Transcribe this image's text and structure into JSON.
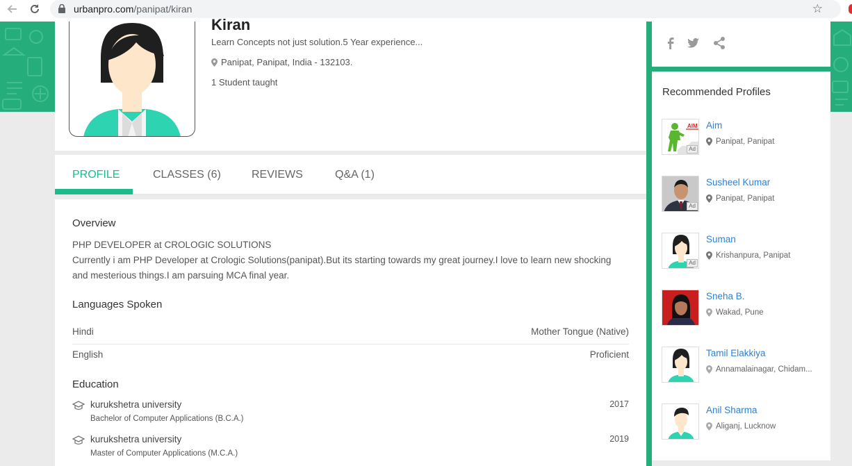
{
  "browser": {
    "url_host": "urbanpro.com",
    "url_path": "/panipat/kiran"
  },
  "profile": {
    "name": "Kiran",
    "tagline": "Learn Concepts not just solution.5 Year experience...",
    "location": "Panipat, Panipat, India - 132103.",
    "students": "1 Student taught"
  },
  "tabs": {
    "profile": "PROFILE",
    "classes": "CLASSES (6)",
    "reviews": "REVIEWS",
    "qa": "Q&A (1)"
  },
  "overview": {
    "title": "Overview",
    "line1": "PHP DEVELOPER at CROLOGIC SOLUTIONS",
    "line2": "Currently i am PHP Developer at Crologic Solutions(panipat).But its starting towards my great journey.I love to learn new shocking and mesterious things.I am parsuing MCA final year."
  },
  "languages": {
    "title": "Languages Spoken",
    "items": [
      {
        "name": "Hindi",
        "level": "Mother Tongue (Native)"
      },
      {
        "name": "English",
        "level": "Proficient"
      }
    ]
  },
  "education": {
    "title": "Education",
    "items": [
      {
        "school": "kurukshetra university",
        "degree": "Bachelor of Computer Applications (B.C.A.)",
        "year": "2017"
      },
      {
        "school": "kurukshetra university",
        "degree": "Master of Computer Applications (M.C.A.)",
        "year": "2019"
      }
    ]
  },
  "recommended": {
    "title": "Recommended Profiles",
    "ad_label": "Ad",
    "items": [
      {
        "name": "Aim",
        "location": "Panipat, Panipat",
        "ad": true,
        "thumb": "aim-logo"
      },
      {
        "name": "Susheel Kumar",
        "location": "Panipat, Panipat",
        "ad": true,
        "thumb": "photo-man"
      },
      {
        "name": "Suman",
        "location": "Krishanpura, Panipat",
        "ad": true,
        "thumb": "avatar-female"
      },
      {
        "name": "Sneha B.",
        "location": "Wakad, Pune",
        "ad": false,
        "thumb": "photo-woman"
      },
      {
        "name": "Tamil Elakkiya",
        "location": "Annamalainagar, Chidam...",
        "ad": false,
        "thumb": "avatar-female"
      },
      {
        "name": "Anil Sharma",
        "location": "Aliganj, Lucknow",
        "ad": false,
        "thumb": "avatar-male"
      }
    ]
  },
  "aim_logo_text": "AIM",
  "colors": {
    "brand_green": "#25ae7c",
    "accent": "#1cbb8c",
    "link": "#2f80d1"
  }
}
